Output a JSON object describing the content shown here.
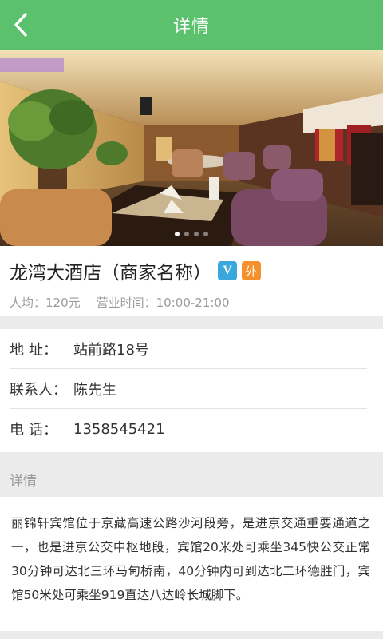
{
  "header": {
    "title": "详情",
    "back_icon": "chevron-left-icon",
    "color": "#5cc16c"
  },
  "carousel": {
    "slide_count": 4,
    "active_index": 0
  },
  "shop": {
    "name": "龙湾大酒店（商家名称）",
    "badge_v": "V",
    "badge_wai": "外",
    "avg_price": "人均：120元",
    "hours": "营业时间：10:00-21:00"
  },
  "info": {
    "address_label_a": "地",
    "address_label_b": "址：",
    "address_value": "站前路18号",
    "contact_label": "联系人：",
    "contact_value": "陈先生",
    "phone_label_a": "电",
    "phone_label_b": "话：",
    "phone_value": "1358545421"
  },
  "details": {
    "title": "详情",
    "text": "丽锦轩宾馆位于京藏高速公路沙河段旁，是进京交通重要通道之一，也是进京公交中枢地段，宾馆20米处可乘坐345快公交正常30分钟可达北三环马甸桥南，40分钟内可到达北二环德胜门，宾馆50米处可乘坐919直达八达岭长城脚下。"
  }
}
